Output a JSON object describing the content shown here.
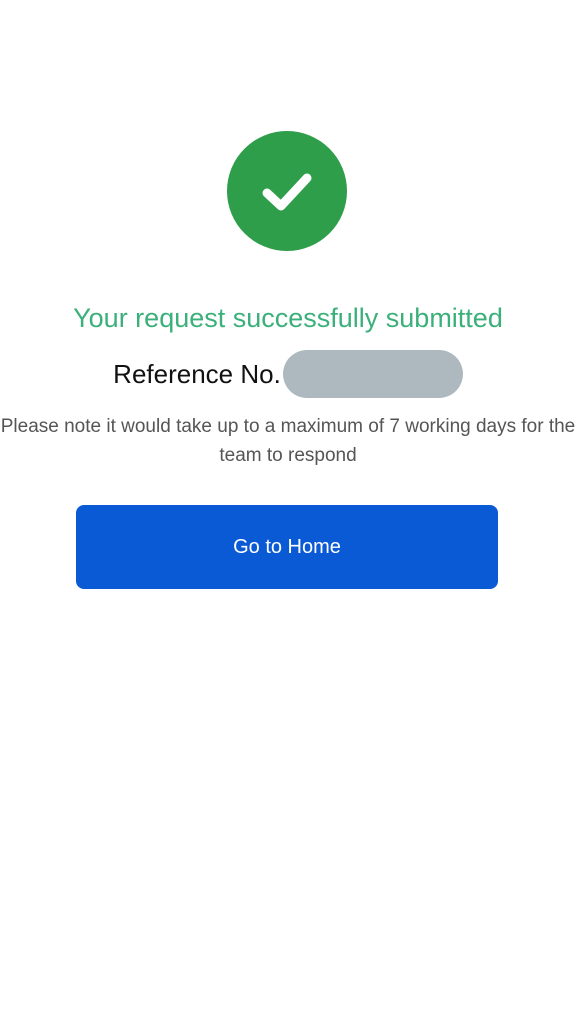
{
  "success": {
    "icon": "check-circle-icon",
    "color": "#2e9e4a"
  },
  "title": "Your request successfully submitted",
  "title_color": "#3bb07a",
  "reference": {
    "label": "Reference No.",
    "value_redacted": true
  },
  "note": "Please note it would take up to a maximum of 7 working days for the team to respond",
  "home_button": {
    "label": "Go to Home",
    "color": "#0a5ad6"
  }
}
